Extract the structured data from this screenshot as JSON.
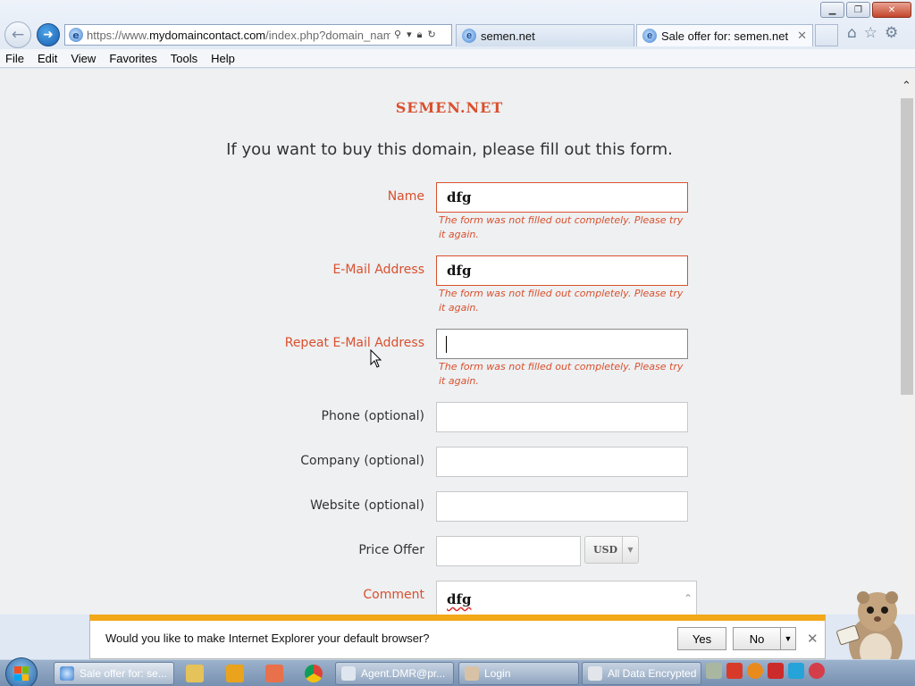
{
  "browser": {
    "url_prefix": "https://www.",
    "url_domain": "mydomaincontact.com",
    "url_rest": "/index.php?domain_name=",
    "tabs": [
      {
        "label": "semen.net"
      },
      {
        "label": "Sale offer for: semen.net"
      }
    ],
    "menu": [
      "File",
      "Edit",
      "View",
      "Favorites",
      "Tools",
      "Help"
    ]
  },
  "page": {
    "site_title": "SEMEN.NET",
    "intro": "If you want to buy this domain, please fill out this form.",
    "error_message": "The form was not filled out completely. Please try it again.",
    "fields": {
      "name": {
        "label": "Name",
        "value": "dfg"
      },
      "email": {
        "label": "E-Mail Address",
        "value": "dfg"
      },
      "repeat_email": {
        "label": "Repeat E-Mail Address",
        "value": ""
      },
      "phone": {
        "label": "Phone (optional)",
        "value": ""
      },
      "company": {
        "label": "Company (optional)",
        "value": ""
      },
      "website": {
        "label": "Website (optional)",
        "value": ""
      },
      "price": {
        "label": "Price Offer",
        "value": "",
        "currency": "USD"
      },
      "comment": {
        "label": "Comment",
        "value": "dfg"
      }
    },
    "colors": {
      "accent": "#d9502d",
      "background": "#eef0f2"
    }
  },
  "notification": {
    "text": "Would you like to make Internet Explorer your default browser?",
    "yes": "Yes",
    "no": "No"
  },
  "taskbar": {
    "tasks": [
      {
        "label": "Sale offer for: se..."
      },
      {
        "label": "Agent.DMR@pr..."
      },
      {
        "label": "Login"
      },
      {
        "label": "All Data Encrypted"
      }
    ]
  }
}
